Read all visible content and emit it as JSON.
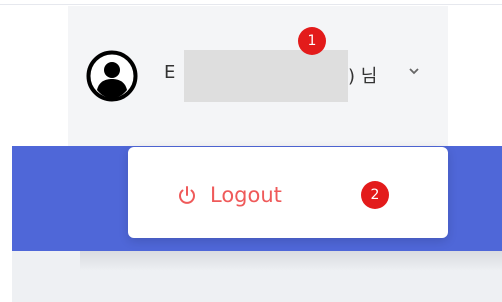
{
  "user_menu": {
    "name_prefix": "E",
    "name_suffix": ") 님",
    "chevron": "chevron-down-icon",
    "avatar": "user-avatar-icon"
  },
  "dropdown": {
    "logout_label": "Logout",
    "logout_icon": "power-icon"
  },
  "annotations": {
    "badge_1": "1",
    "badge_2": "2"
  },
  "colors": {
    "accent_blue": "#4f67d8",
    "logout_red": "#ef5a5a",
    "badge_red": "#e31b1b"
  }
}
